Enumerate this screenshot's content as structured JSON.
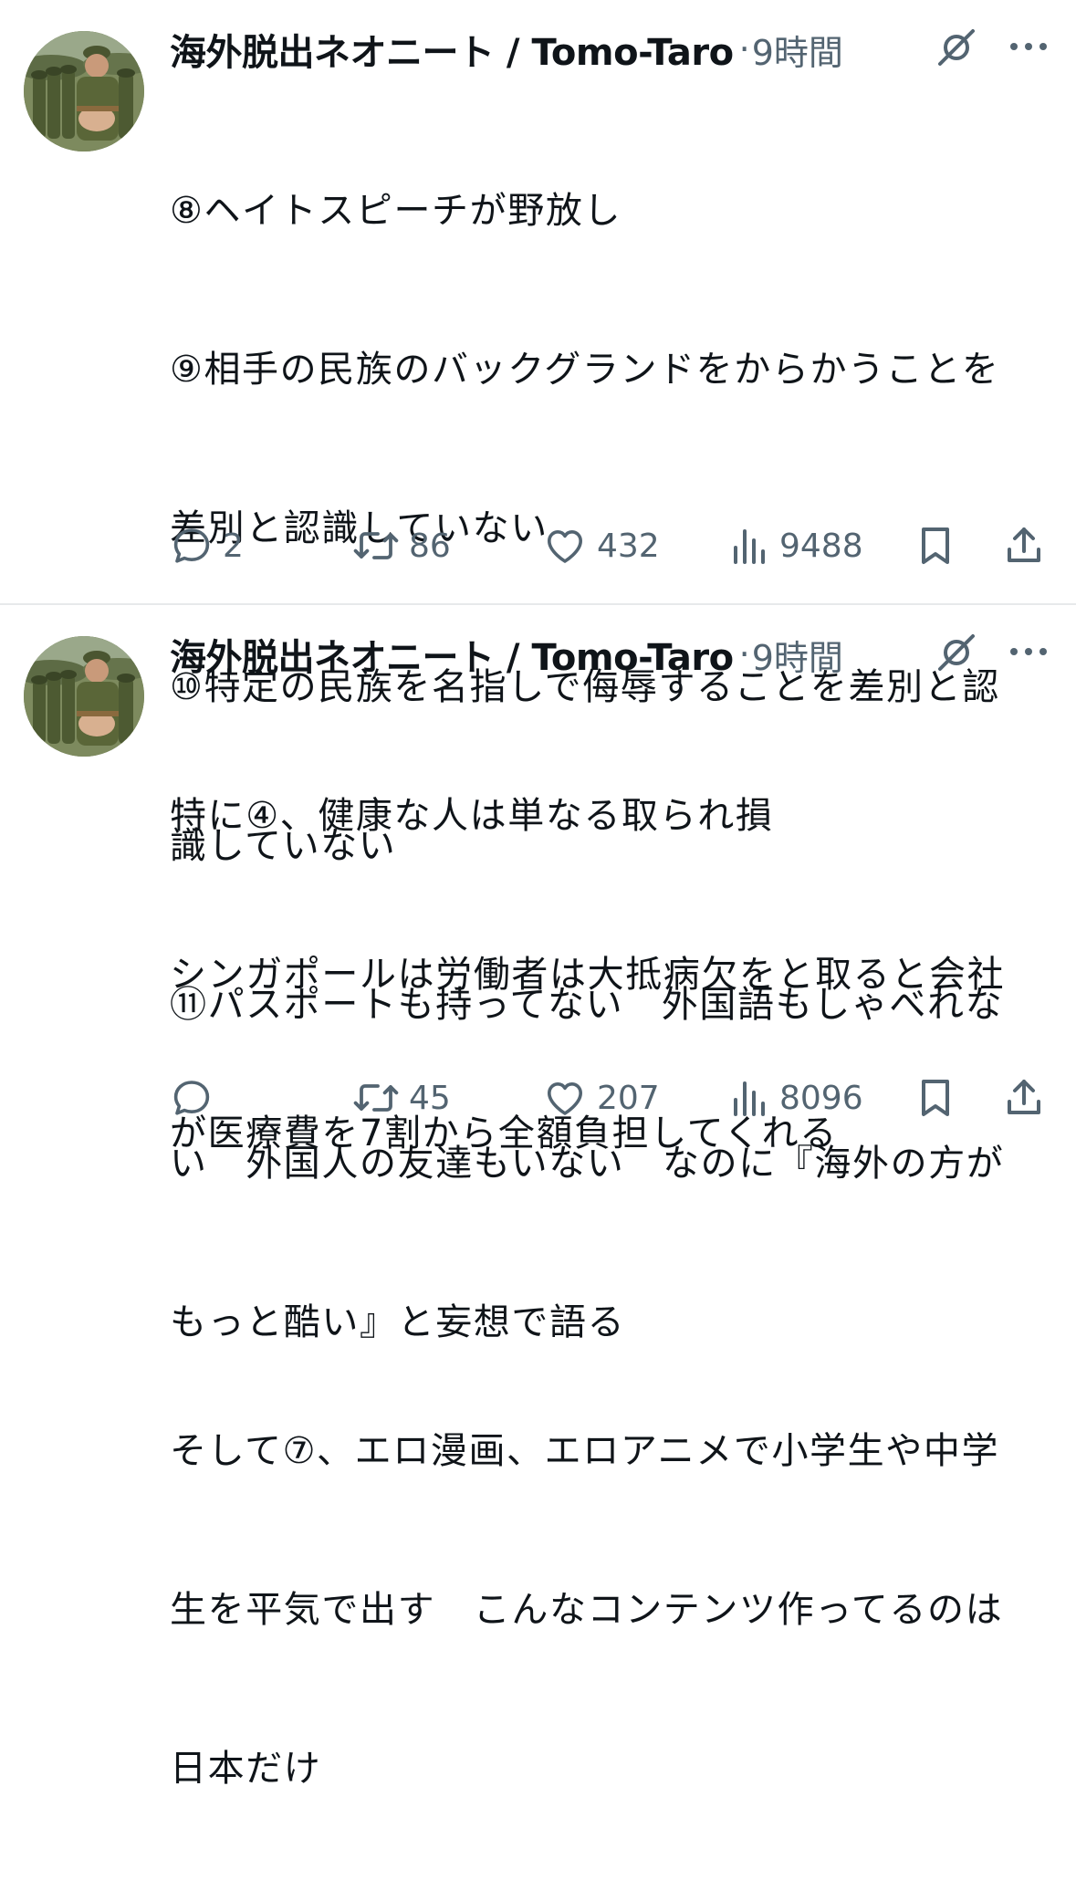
{
  "tweets": [
    {
      "author": {
        "display_name": "海外脱出ネオニート / Tomo-Taro",
        "avatar": "avatar-soldiers-photo"
      },
      "separator": "·",
      "time": "9時間",
      "text_lines": [
        "⑧ヘイトスピーチが野放し",
        "⑨相手の民族のバックグランドをからかうことを",
        "差別と認識していない",
        "⑩特定の民族を名指しで侮辱することを差別と認",
        "識していない",
        "⑪パスポートも持ってない　外国語もしゃべれな",
        "い　外国人の友達もいない　なのに『海外の方が",
        "もっと酷い』と妄想で語る"
      ],
      "stats": {
        "replies": "2",
        "retweets": "86",
        "likes": "432",
        "views": "9488"
      }
    },
    {
      "author": {
        "display_name": "海外脱出ネオニート / Tomo-Taro",
        "avatar": "avatar-soldiers-photo"
      },
      "separator": "·",
      "time": "9時間",
      "text_lines": [
        "特に④、健康な人は単なる取られ損",
        "シンガポールは労働者は大抵病欠をと取ると会社",
        "が医療費を7割から全額負担してくれる",
        "",
        "そして⑦、エロ漫画、エロアニメで小学生や中学",
        "生を平気で出す　こんなコンテンツ作ってるのは",
        "日本だけ"
      ],
      "stats": {
        "replies": "",
        "retweets": "45",
        "likes": "207",
        "views": "8096"
      }
    }
  ],
  "icons": {
    "reply": "reply-icon",
    "retweet": "retweet-icon",
    "like": "heart-icon",
    "views": "views-chart-icon",
    "bookmark": "bookmark-icon",
    "share": "share-icon",
    "grok": "grok-icon",
    "more": "more-dots-icon"
  },
  "colors": {
    "text_primary": "#0f1419",
    "text_secondary": "#536471",
    "divider": "#e7e9eb",
    "background": "#ffffff"
  }
}
